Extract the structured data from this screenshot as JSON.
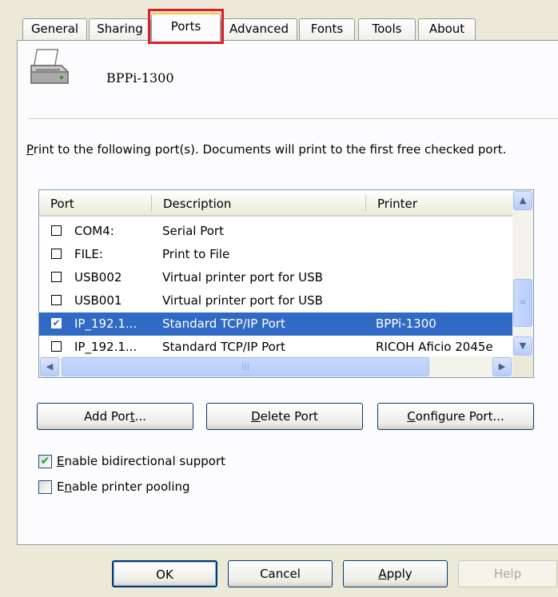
{
  "tabs": [
    {
      "label": "General"
    },
    {
      "label": "Sharing"
    },
    {
      "label": "Ports"
    },
    {
      "label": "Advanced"
    },
    {
      "label": "Fonts"
    },
    {
      "label": "Tools"
    },
    {
      "label": "About"
    }
  ],
  "printer": {
    "name": "BPPi-1300",
    "icon": "printer-icon"
  },
  "instructions": {
    "prefix": "P",
    "text": "rint to the following port(s). Documents will print to the first free checked port."
  },
  "port_list": {
    "columns": [
      "Port",
      "Description",
      "Printer"
    ],
    "rows": [
      {
        "checked": false,
        "port": "COM4:",
        "description": "Serial Port",
        "printer": ""
      },
      {
        "checked": false,
        "port": "FILE:",
        "description": "Print to File",
        "printer": ""
      },
      {
        "checked": false,
        "port": "USB002",
        "description": "Virtual printer port for USB",
        "printer": ""
      },
      {
        "checked": false,
        "port": "USB001",
        "description": "Virtual printer port for USB",
        "printer": ""
      },
      {
        "checked": true,
        "port": "IP_192.1...",
        "description": "Standard TCP/IP Port",
        "printer": "BPPi-1300"
      },
      {
        "checked": false,
        "port": "IP_192.1...",
        "description": "Standard TCP/IP Port",
        "printer": "RICOH Aficio 2045e"
      }
    ],
    "selected_index": 4
  },
  "port_buttons": {
    "add": {
      "pre": "Add Por",
      "key": "t",
      "post": "..."
    },
    "delete": {
      "pre": "",
      "key": "D",
      "post": "elete Port"
    },
    "configure": {
      "pre": "",
      "key": "C",
      "post": "onfigure Port..."
    }
  },
  "options": {
    "bidirectional": {
      "key": "E",
      "rest": "nable bidirectional support",
      "checked": true
    },
    "pooling": {
      "key": "n",
      "pre": "E",
      "rest": "able printer pooling",
      "checked": false
    }
  },
  "dialog_buttons": {
    "ok": "OK",
    "cancel": "Cancel",
    "apply": {
      "key": "A",
      "rest": "pply"
    },
    "help": "Help"
  },
  "colors": {
    "selection": "#316ac5",
    "highlight_box": "#e01e2a",
    "active_tab_accent": "#ffc83c"
  }
}
